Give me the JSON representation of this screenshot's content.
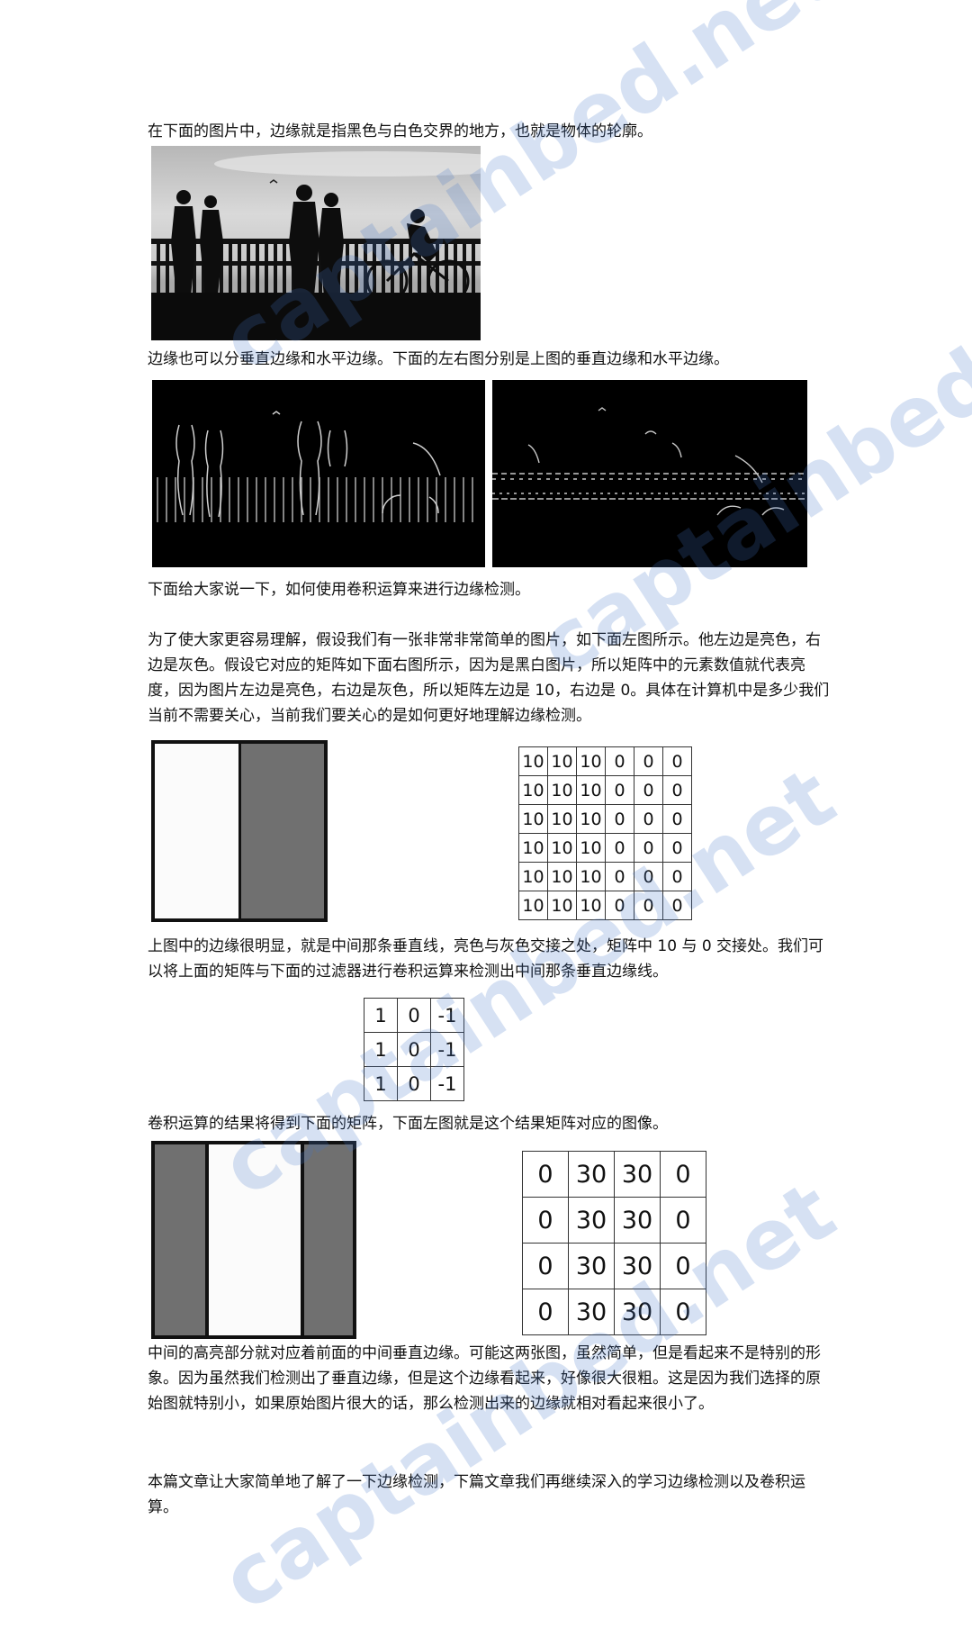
{
  "paragraphs": {
    "p1": "在下面的图片中，边缘就是指黑色与白色交界的地方，也就是物体的轮廓。",
    "p2": "边缘也可以分垂直边缘和水平边缘。下面的左右图分别是上图的垂直边缘和水平边缘。",
    "p3": "下面给大家说一下，如何使用卷积运算来进行边缘检测。",
    "p4": "为了使大家更容易理解，假设我们有一张非常非常简单的图片，如下面左图所示。他左边是亮色，右边是灰色。假设它对应的矩阵如下面右图所示，因为是黑白图片，所以矩阵中的元素数值就代表亮度，因为图片左边是亮色，右边是灰色，所以矩阵左边是 10，右边是 0。具体在计算机中是多少我们当前不需要关心，当前我们要关心的是如何更好地理解边缘检测。",
    "p5": "上图中的边缘很明显，就是中间那条垂直线，亮色与灰色交接之处，矩阵中 10 与 0 交接处。我们可以将上面的矩阵与下面的过滤器进行卷积运算来检测出中间那条垂直边缘线。",
    "p6": "卷积运算的结果将得到下面的矩阵，下面左图就是这个结果矩阵对应的图像。",
    "p7": "中间的高亮部分就对应着前面的中间垂直边缘。可能这两张图，虽然简单，但是看起来不是特别的形象。因为虽然我们检测出了垂直边缘，但是这个边缘看起来，好像很大很粗。这是因为我们选择的原始图就特别小，如果原始图片很大的话，那么检测出来的边缘就相对看起来很小了。",
    "p8": "本篇文章让大家简单地了解了一下边缘检测，下篇文章我们再继续深入的学习边缘检测以及卷积运算。"
  },
  "input_matrix": [
    [
      "10",
      "10",
      "10",
      "0",
      "0",
      "0"
    ],
    [
      "10",
      "10",
      "10",
      "0",
      "0",
      "0"
    ],
    [
      "10",
      "10",
      "10",
      "0",
      "0",
      "0"
    ],
    [
      "10",
      "10",
      "10",
      "0",
      "0",
      "0"
    ],
    [
      "10",
      "10",
      "10",
      "0",
      "0",
      "0"
    ],
    [
      "10",
      "10",
      "10",
      "0",
      "0",
      "0"
    ]
  ],
  "filter_matrix": [
    [
      "1",
      "0",
      "-1"
    ],
    [
      "1",
      "0",
      "-1"
    ],
    [
      "1",
      "0",
      "-1"
    ]
  ],
  "result_matrix": [
    [
      "0",
      "30",
      "30",
      "0"
    ],
    [
      "0",
      "30",
      "30",
      "0"
    ],
    [
      "0",
      "30",
      "30",
      "0"
    ],
    [
      "0",
      "30",
      "30",
      "0"
    ]
  ],
  "watermark": "captainbed.net",
  "colors": {
    "watermark": "#4678c8",
    "bright": "#fbfbfb",
    "gray": "#707070"
  }
}
